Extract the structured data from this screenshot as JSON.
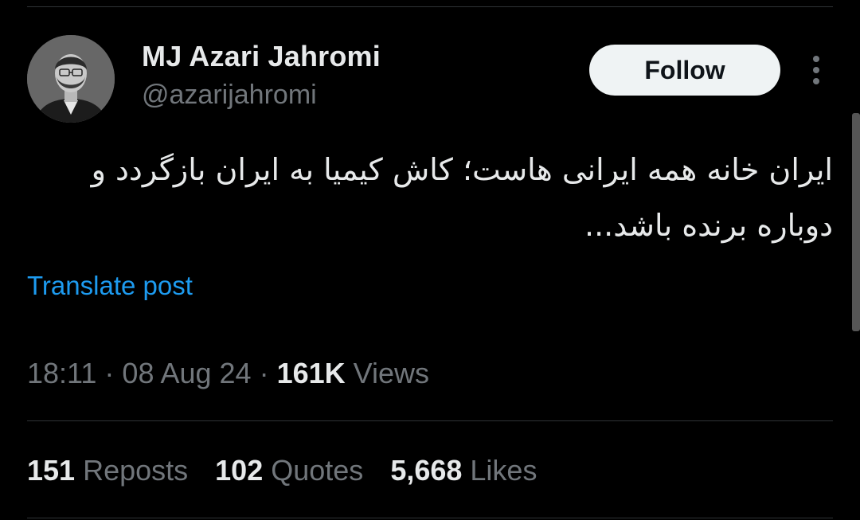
{
  "author": {
    "display_name": "MJ Azari Jahromi",
    "handle": "@azarijahromi"
  },
  "actions": {
    "follow_label": "Follow",
    "more_icon": "more-vertical-icon"
  },
  "tweet": {
    "text": "ایران خانه همه ایرانی هاست؛ کاش کیمیا به ایران بازگردد و دوباره برنده باشد...",
    "translate_label": "Translate post"
  },
  "meta": {
    "time": "18:11",
    "separator": " · ",
    "date": "08 Aug 24",
    "views_count": "161K",
    "views_label": " Views"
  },
  "stats": {
    "reposts_count": "151",
    "reposts_label": " Reposts",
    "quotes_count": "102",
    "quotes_label": " Quotes",
    "likes_count": "5,668",
    "likes_label": " Likes"
  },
  "colors": {
    "background": "#000000",
    "text_primary": "#e7e9ea",
    "text_secondary": "#71767b",
    "link": "#1d9bf0",
    "follow_bg": "#eff3f4",
    "divider": "#2f3336"
  }
}
